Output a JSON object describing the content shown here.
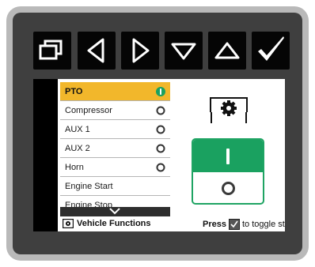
{
  "buttons": [
    {
      "name": "windows-button",
      "icon": "windows-icon"
    },
    {
      "name": "left-button",
      "icon": "triangle-left-icon"
    },
    {
      "name": "right-button",
      "icon": "triangle-right-icon"
    },
    {
      "name": "down-button",
      "icon": "triangle-down-icon"
    },
    {
      "name": "up-button",
      "icon": "triangle-up-icon"
    },
    {
      "name": "confirm-button",
      "icon": "checkmark-icon"
    }
  ],
  "list": {
    "items": [
      {
        "label": "PTO",
        "state": "on",
        "selected": true
      },
      {
        "label": "Compressor",
        "state": "off",
        "selected": false
      },
      {
        "label": "AUX 1",
        "state": "off",
        "selected": false
      },
      {
        "label": "AUX 2",
        "state": "off",
        "selected": false
      },
      {
        "label": "Horn",
        "state": "off",
        "selected": false
      },
      {
        "label": "Engine Start",
        "state": "",
        "selected": false
      },
      {
        "label": "Engine Stop",
        "state": "",
        "selected": false
      }
    ]
  },
  "status": {
    "section_label": "Vehicle Functions",
    "press_label": "Press",
    "hint_label": "to toggle state"
  },
  "colors": {
    "selected": "#f2b72b",
    "on_green": "#1aa160"
  }
}
